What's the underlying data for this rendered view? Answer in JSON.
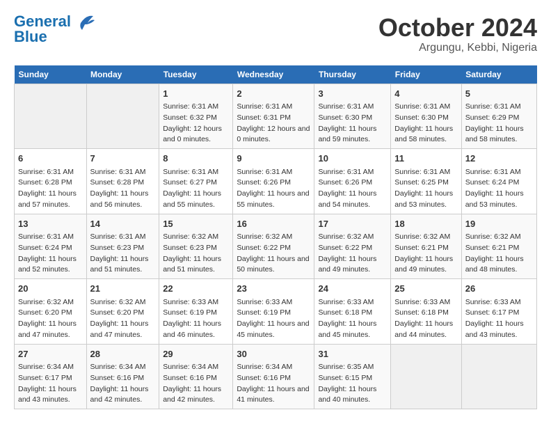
{
  "header": {
    "logo_line1": "General",
    "logo_line2": "Blue",
    "title": "October 2024",
    "subtitle": "Argungu, Kebbi, Nigeria"
  },
  "weekdays": [
    "Sunday",
    "Monday",
    "Tuesday",
    "Wednesday",
    "Thursday",
    "Friday",
    "Saturday"
  ],
  "weeks": [
    [
      {
        "day": "",
        "empty": true
      },
      {
        "day": "",
        "empty": true
      },
      {
        "day": "1",
        "sunrise": "Sunrise: 6:31 AM",
        "sunset": "Sunset: 6:32 PM",
        "daylight": "Daylight: 12 hours and 0 minutes."
      },
      {
        "day": "2",
        "sunrise": "Sunrise: 6:31 AM",
        "sunset": "Sunset: 6:31 PM",
        "daylight": "Daylight: 12 hours and 0 minutes."
      },
      {
        "day": "3",
        "sunrise": "Sunrise: 6:31 AM",
        "sunset": "Sunset: 6:30 PM",
        "daylight": "Daylight: 11 hours and 59 minutes."
      },
      {
        "day": "4",
        "sunrise": "Sunrise: 6:31 AM",
        "sunset": "Sunset: 6:30 PM",
        "daylight": "Daylight: 11 hours and 58 minutes."
      },
      {
        "day": "5",
        "sunrise": "Sunrise: 6:31 AM",
        "sunset": "Sunset: 6:29 PM",
        "daylight": "Daylight: 11 hours and 58 minutes."
      }
    ],
    [
      {
        "day": "6",
        "sunrise": "Sunrise: 6:31 AM",
        "sunset": "Sunset: 6:28 PM",
        "daylight": "Daylight: 11 hours and 57 minutes."
      },
      {
        "day": "7",
        "sunrise": "Sunrise: 6:31 AM",
        "sunset": "Sunset: 6:28 PM",
        "daylight": "Daylight: 11 hours and 56 minutes."
      },
      {
        "day": "8",
        "sunrise": "Sunrise: 6:31 AM",
        "sunset": "Sunset: 6:27 PM",
        "daylight": "Daylight: 11 hours and 55 minutes."
      },
      {
        "day": "9",
        "sunrise": "Sunrise: 6:31 AM",
        "sunset": "Sunset: 6:26 PM",
        "daylight": "Daylight: 11 hours and 55 minutes."
      },
      {
        "day": "10",
        "sunrise": "Sunrise: 6:31 AM",
        "sunset": "Sunset: 6:26 PM",
        "daylight": "Daylight: 11 hours and 54 minutes."
      },
      {
        "day": "11",
        "sunrise": "Sunrise: 6:31 AM",
        "sunset": "Sunset: 6:25 PM",
        "daylight": "Daylight: 11 hours and 53 minutes."
      },
      {
        "day": "12",
        "sunrise": "Sunrise: 6:31 AM",
        "sunset": "Sunset: 6:24 PM",
        "daylight": "Daylight: 11 hours and 53 minutes."
      }
    ],
    [
      {
        "day": "13",
        "sunrise": "Sunrise: 6:31 AM",
        "sunset": "Sunset: 6:24 PM",
        "daylight": "Daylight: 11 hours and 52 minutes."
      },
      {
        "day": "14",
        "sunrise": "Sunrise: 6:31 AM",
        "sunset": "Sunset: 6:23 PM",
        "daylight": "Daylight: 11 hours and 51 minutes."
      },
      {
        "day": "15",
        "sunrise": "Sunrise: 6:32 AM",
        "sunset": "Sunset: 6:23 PM",
        "daylight": "Daylight: 11 hours and 51 minutes."
      },
      {
        "day": "16",
        "sunrise": "Sunrise: 6:32 AM",
        "sunset": "Sunset: 6:22 PM",
        "daylight": "Daylight: 11 hours and 50 minutes."
      },
      {
        "day": "17",
        "sunrise": "Sunrise: 6:32 AM",
        "sunset": "Sunset: 6:22 PM",
        "daylight": "Daylight: 11 hours and 49 minutes."
      },
      {
        "day": "18",
        "sunrise": "Sunrise: 6:32 AM",
        "sunset": "Sunset: 6:21 PM",
        "daylight": "Daylight: 11 hours and 49 minutes."
      },
      {
        "day": "19",
        "sunrise": "Sunrise: 6:32 AM",
        "sunset": "Sunset: 6:21 PM",
        "daylight": "Daylight: 11 hours and 48 minutes."
      }
    ],
    [
      {
        "day": "20",
        "sunrise": "Sunrise: 6:32 AM",
        "sunset": "Sunset: 6:20 PM",
        "daylight": "Daylight: 11 hours and 47 minutes."
      },
      {
        "day": "21",
        "sunrise": "Sunrise: 6:32 AM",
        "sunset": "Sunset: 6:20 PM",
        "daylight": "Daylight: 11 hours and 47 minutes."
      },
      {
        "day": "22",
        "sunrise": "Sunrise: 6:33 AM",
        "sunset": "Sunset: 6:19 PM",
        "daylight": "Daylight: 11 hours and 46 minutes."
      },
      {
        "day": "23",
        "sunrise": "Sunrise: 6:33 AM",
        "sunset": "Sunset: 6:19 PM",
        "daylight": "Daylight: 11 hours and 45 minutes."
      },
      {
        "day": "24",
        "sunrise": "Sunrise: 6:33 AM",
        "sunset": "Sunset: 6:18 PM",
        "daylight": "Daylight: 11 hours and 45 minutes."
      },
      {
        "day": "25",
        "sunrise": "Sunrise: 6:33 AM",
        "sunset": "Sunset: 6:18 PM",
        "daylight": "Daylight: 11 hours and 44 minutes."
      },
      {
        "day": "26",
        "sunrise": "Sunrise: 6:33 AM",
        "sunset": "Sunset: 6:17 PM",
        "daylight": "Daylight: 11 hours and 43 minutes."
      }
    ],
    [
      {
        "day": "27",
        "sunrise": "Sunrise: 6:34 AM",
        "sunset": "Sunset: 6:17 PM",
        "daylight": "Daylight: 11 hours and 43 minutes."
      },
      {
        "day": "28",
        "sunrise": "Sunrise: 6:34 AM",
        "sunset": "Sunset: 6:16 PM",
        "daylight": "Daylight: 11 hours and 42 minutes."
      },
      {
        "day": "29",
        "sunrise": "Sunrise: 6:34 AM",
        "sunset": "Sunset: 6:16 PM",
        "daylight": "Daylight: 11 hours and 42 minutes."
      },
      {
        "day": "30",
        "sunrise": "Sunrise: 6:34 AM",
        "sunset": "Sunset: 6:16 PM",
        "daylight": "Daylight: 11 hours and 41 minutes."
      },
      {
        "day": "31",
        "sunrise": "Sunrise: 6:35 AM",
        "sunset": "Sunset: 6:15 PM",
        "daylight": "Daylight: 11 hours and 40 minutes."
      },
      {
        "day": "",
        "empty": true
      },
      {
        "day": "",
        "empty": true
      }
    ]
  ]
}
